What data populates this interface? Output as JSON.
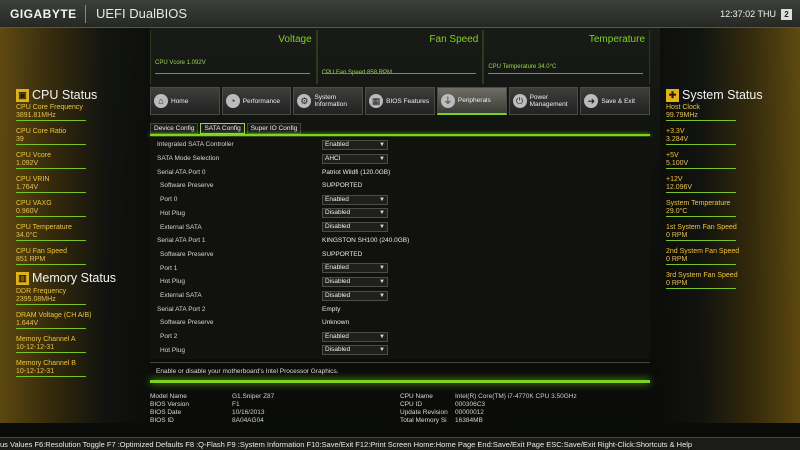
{
  "topbar": {
    "brand": "GIGABYTE",
    "product": "UEFI DualBIOS",
    "time": "12:37:02 THU",
    "badge": "2"
  },
  "monitor": {
    "voltage": {
      "title": "Voltage",
      "reading": "CPU Vcore     1.092V"
    },
    "fanspeed": {
      "title": "Fan Speed",
      "reading": "CPU Fan Speed       858 RPM"
    },
    "temperature": {
      "title": "Temperature",
      "reading": "CPU Temperature      34.0°C"
    }
  },
  "cpu_status": {
    "title": "CPU Status",
    "items": [
      {
        "label": "CPU Core Frequency",
        "value": "3891.81MHz"
      },
      {
        "label": "CPU Core Ratio",
        "value": "39"
      },
      {
        "label": "CPU Vcore",
        "value": "1.092V"
      },
      {
        "label": "CPU VRIN",
        "value": "1.764V"
      },
      {
        "label": "CPU VAXG",
        "value": "0.960V"
      },
      {
        "label": "CPU Temperature",
        "value": "34.0°C"
      },
      {
        "label": "CPU Fan Speed",
        "value": "851 RPM"
      }
    ]
  },
  "memory_status": {
    "title": "Memory Status",
    "items": [
      {
        "label": "DDR Frequency",
        "value": "2395.08MHz"
      },
      {
        "label": "DRAM Voltage      (CH A/B)",
        "value": "1.644V"
      },
      {
        "label": "Memory Channel A",
        "value": "10-12-12-31"
      },
      {
        "label": "Memory Channel B",
        "value": "10-12-12-31"
      }
    ]
  },
  "system_status": {
    "title": "System Status",
    "items": [
      {
        "label": "Host Clock",
        "value": "99.79MHz"
      },
      {
        "label": "+3.3V",
        "value": "3.284V"
      },
      {
        "label": "+5V",
        "value": "5.100V"
      },
      {
        "label": "+12V",
        "value": "12.096V"
      },
      {
        "label": "System Temperature",
        "value": "29.0°C"
      },
      {
        "label": "1st System Fan Speed",
        "value": "0 RPM"
      },
      {
        "label": "2nd System Fan Speed",
        "value": "0 RPM"
      },
      {
        "label": "3rd System Fan Speed",
        "value": "0 RPM"
      }
    ]
  },
  "nav": [
    {
      "label": "Home",
      "icon": "home-icon"
    },
    {
      "label": "Performance",
      "icon": "gauge-icon"
    },
    {
      "label": "System Information",
      "icon": "gear-icon"
    },
    {
      "label": "BIOS Features",
      "icon": "chip-icon"
    },
    {
      "label": "Peripherals",
      "icon": "plug-icon"
    },
    {
      "label": "Power Management",
      "icon": "power-icon"
    },
    {
      "label": "Save & Exit",
      "icon": "exit-icon"
    }
  ],
  "subtabs": [
    "Device Config",
    "SATA Config",
    "Super IO Config"
  ],
  "settings": [
    {
      "label": "Integrated SATA Controller",
      "value": "Enabled"
    },
    {
      "label": "SATA Mode Selection",
      "value": "AHCI"
    },
    {
      "label": "Serial ATA Port 0",
      "value": "Patriot Wildfi (120.0GB)"
    },
    {
      "label": "Software Preserve",
      "value": "SUPPORTED"
    },
    {
      "label": "Port 0",
      "value": "Enabled"
    },
    {
      "label": "Hot Plug",
      "value": "Disabled"
    },
    {
      "label": "External SATA",
      "value": "Disabled"
    },
    {
      "label": "Serial ATA Port 1",
      "value": "KINGSTON SH100 (240.0GB)"
    },
    {
      "label": "Software Preserve",
      "value": "SUPPORTED"
    },
    {
      "label": "Port 1",
      "value": "Enabled"
    },
    {
      "label": "Hot Plug",
      "value": "Disabled"
    },
    {
      "label": "External SATA",
      "value": "Disabled"
    },
    {
      "label": "Serial ATA Port 2",
      "value": "Empty"
    },
    {
      "label": "Software Preserve",
      "value": "Unknown"
    },
    {
      "label": "Port 2",
      "value": "Enabled"
    },
    {
      "label": "Hot Plug",
      "value": "Disabled"
    }
  ],
  "help_text": "Enable or disable your motherboard's Intel Processor Graphics.",
  "sysinfo": {
    "left": [
      {
        "k": "Model Name",
        "v": "G1.Sniper Z87"
      },
      {
        "k": "BIOS Version",
        "v": "F1"
      },
      {
        "k": "BIOS Date",
        "v": "10/16/2013"
      },
      {
        "k": "BIOS ID",
        "v": "8A04AG04"
      }
    ],
    "right": [
      {
        "k": "CPU Name",
        "v": "Intel(R) Core(TM) i7-4770K CPU  3.50GHz"
      },
      {
        "k": "CPU ID",
        "v": "000306C3"
      },
      {
        "k": "Update Revision",
        "v": "00000012"
      },
      {
        "k": "Total Memory Si",
        "v": "16384MB"
      }
    ]
  },
  "bottom_help": "us Values F6:Resolution Toggle F7 :Optimized Defaults F8 :Q-Flash F9 :System Information F10:Save/Exit F12:Print Screen Home:Home Page End:Save/Exit Page ESC:Save/Exit Right-Click:Shortcuts & Help"
}
